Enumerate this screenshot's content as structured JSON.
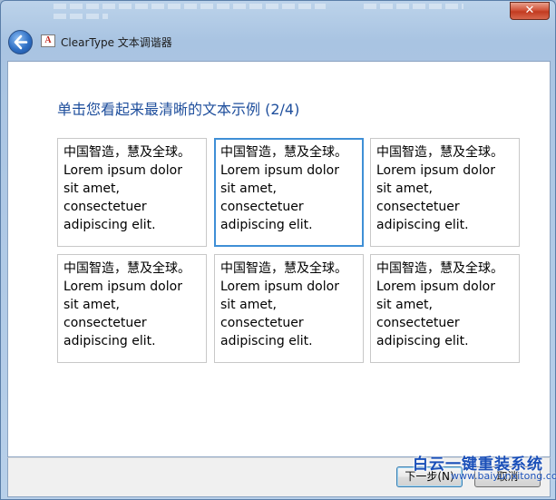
{
  "window": {
    "title": "ClearType 文本调谐器",
    "app_icon_letter": "A",
    "close_glyph": "✕"
  },
  "page": {
    "heading": "单击您看起来最清晰的文本示例 (2/4)"
  },
  "samples": [
    {
      "text": "中国智造，慧及全球。\nLorem ipsum dolor\nsit amet,\nconsectetuer\nadipiscing elit.",
      "selected": false
    },
    {
      "text": "中国智造，慧及全球。\nLorem ipsum dolor\nsit amet,\nconsectetuer\nadipiscing elit.",
      "selected": true
    },
    {
      "text": "中国智造，慧及全球。\nLorem ipsum dolor\nsit amet,\nconsectetuer\nadipiscing elit.",
      "selected": false
    },
    {
      "text": "中国智造，慧及全球。\nLorem ipsum dolor\nsit amet,\nconsectetuer\nadipiscing elit.",
      "selected": false
    },
    {
      "text": "中国智造，慧及全球。\nLorem ipsum dolor\nsit amet,\nconsectetuer\nadipiscing elit.",
      "selected": false
    },
    {
      "text": "中国智造，慧及全球。\nLorem ipsum dolor\nsit amet,\nconsectetuer\nadipiscing elit.",
      "selected": false
    }
  ],
  "footer": {
    "next_label": "下一步(N)",
    "cancel_label": "取消"
  },
  "watermark": {
    "main": "白云一键重装系统",
    "sub": "www.baiyunxitong.com"
  },
  "colors": {
    "heading": "#1e4e9c",
    "selection_border": "#3f8fd6",
    "close_button": "#c23b20"
  }
}
